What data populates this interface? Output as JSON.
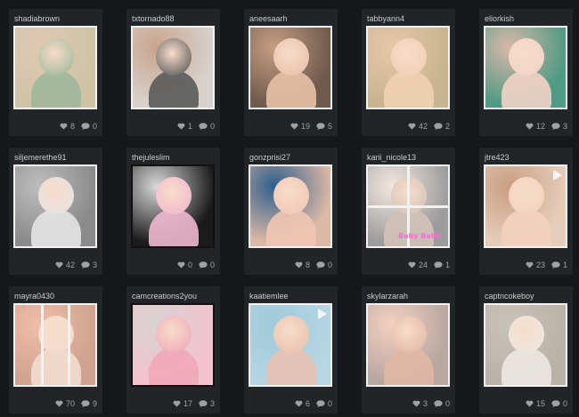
{
  "cards": [
    {
      "username": "shadiabrown",
      "likes": "8",
      "comments": "0",
      "colors": [
        "#cfc3a7",
        "#9fb89a",
        "#e0c8b2"
      ]
    },
    {
      "username": "txtornado88",
      "likes": "1",
      "comments": "0",
      "colors": [
        "#d7d2cd",
        "#5a5a5a",
        "#c9a48c"
      ]
    },
    {
      "username": "aneesaarh",
      "likes": "19",
      "comments": "5",
      "colors": [
        "#6f5a4c",
        "#e7c1a7",
        "#c59e83"
      ]
    },
    {
      "username": "tabbyann4",
      "likes": "42",
      "comments": "2",
      "colors": [
        "#c9b48f",
        "#f0d0b4",
        "#e6c7a8"
      ]
    },
    {
      "username": "eliorkish",
      "likes": "12",
      "comments": "3",
      "colors": [
        "#4e9a84",
        "#f2d3c5",
        "#d9b8a8"
      ]
    },
    {
      "username": "siljemerethe91",
      "likes": "42",
      "comments": "3",
      "colors": [
        "#8a8a8a",
        "#e4e4e4",
        "#bdbdbd"
      ]
    },
    {
      "username": "thejuleslim",
      "likes": "0",
      "comments": "0",
      "colors": [
        "#1b1b1b",
        "#f0b8cf",
        "#d8d8d8"
      ]
    },
    {
      "username": "gonzprisi27",
      "likes": "8",
      "comments": "0",
      "colors": [
        "#dcb9a6",
        "#f0c7b4",
        "#2f5e8c"
      ]
    },
    {
      "username": "karii_nicole13",
      "likes": "24",
      "comments": "1",
      "colors": [
        "#9c9c9c",
        "#d2c2b7",
        "#f2e7e0"
      ],
      "overlay": "Baby Bath!"
    },
    {
      "username": "jtre423",
      "likes": "23",
      "comments": "1",
      "colors": [
        "#e6cdb9",
        "#f2d2bf",
        "#c89f83"
      ]
    },
    {
      "username": "mayra0430",
      "likes": "70",
      "comments": "9",
      "colors": [
        "#cfa38f",
        "#f2dbcf",
        "#f0bda8"
      ]
    },
    {
      "username": "camcreations2you",
      "likes": "17",
      "comments": "3",
      "colors": [
        "#f2c3cf",
        "#f0a7b9",
        "#d8d2d2"
      ]
    },
    {
      "username": "kaatiemlee",
      "likes": "6",
      "comments": "0",
      "colors": [
        "#b7d5e3",
        "#e8c1b0",
        "#9ecad9"
      ]
    },
    {
      "username": "skylarzarah",
      "likes": "3",
      "comments": "0",
      "colors": [
        "#b8a6a0",
        "#e0b7a4",
        "#f3d0c0"
      ]
    },
    {
      "username": "captncokeboy",
      "likes": "15",
      "comments": "0",
      "colors": [
        "#b9b2a7",
        "#ece8e2",
        "#c8c3ba"
      ]
    }
  ]
}
